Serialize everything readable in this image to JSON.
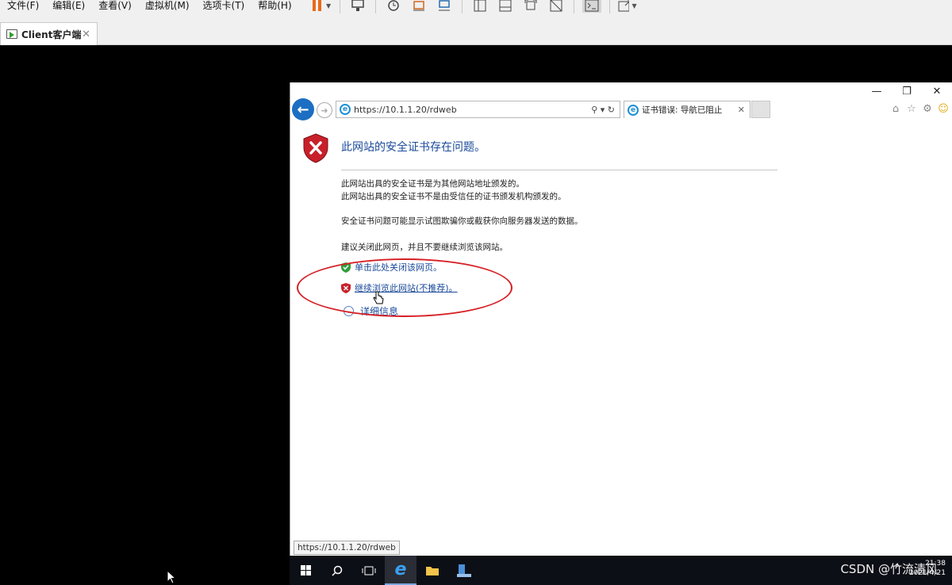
{
  "vmware": {
    "menu": [
      "文件(F)",
      "编辑(E)",
      "查看(V)",
      "虚拟机(M)",
      "选项卡(T)",
      "帮助(H)"
    ],
    "tab_label": "Client客户端"
  },
  "ie": {
    "address": "https://10.1.1.20/rdweb",
    "tab_title": "证书错误: 导航已阻止",
    "page": {
      "title": "此网站的安全证书存在问题。",
      "line1": "此网站出具的安全证书是为其他网站地址颁发的。",
      "line2": "此网站出具的安全证书不是由受信任的证书颁发机构颁发的。",
      "line3": "安全证书问题可能显示试图欺骗你或截获你向服务器发送的数据。",
      "line4": "建议关闭此网页，并且不要继续浏览该网站。",
      "close_link": "单击此处关闭该网页。",
      "continue_link": "继续浏览此网站(不推荐)。",
      "more_info": "详细信息"
    },
    "status_url": "https://10.1.1.20/rdweb"
  },
  "taskbar": {
    "time": "21:38",
    "date": "2021/4/21"
  },
  "watermark": "CSDN @竹流清风"
}
